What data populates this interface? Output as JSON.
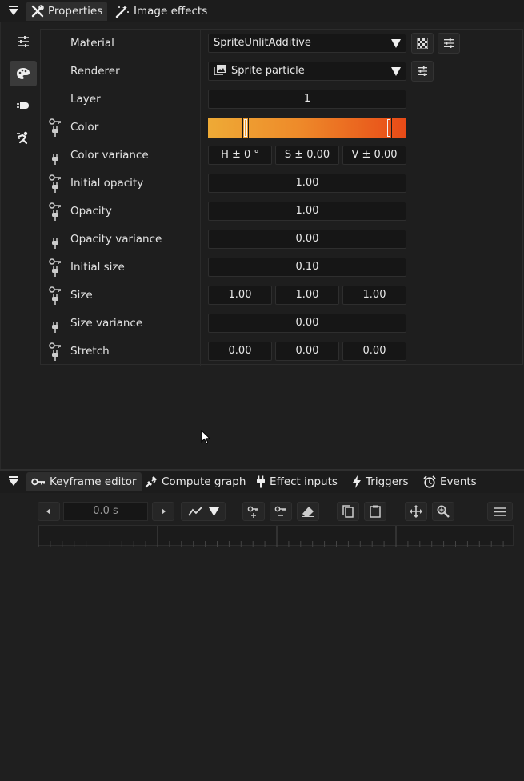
{
  "top_tabs": {
    "properties": "Properties",
    "image_effects": "Image effects"
  },
  "sidebar": {
    "items": [
      "settings-sliders-icon",
      "palette-icon",
      "particle-bullet-icon",
      "physics-person-icon"
    ],
    "active": "palette-icon"
  },
  "properties": {
    "material": {
      "label": "Material",
      "value": "SpriteUnlitAdditive"
    },
    "renderer": {
      "label": "Renderer",
      "value": "Sprite particle"
    },
    "layer": {
      "label": "Layer",
      "value": "1"
    },
    "color": {
      "label": "Color",
      "gradient_start": "#eeaa36",
      "gradient_end": "#e84a17"
    },
    "color_variance": {
      "label": "Color variance",
      "h": "H ± 0 °",
      "s": "S ± 0.00",
      "v": "V ± 0.00"
    },
    "initial_opacity": {
      "label": "Initial opacity",
      "value": "1.00"
    },
    "opacity": {
      "label": "Opacity",
      "value": "1.00"
    },
    "opacity_variance": {
      "label": "Opacity variance",
      "value": "0.00"
    },
    "initial_size": {
      "label": "Initial size",
      "value": "0.10"
    },
    "size": {
      "label": "Size",
      "x": "1.00",
      "y": "1.00",
      "z": "1.00"
    },
    "size_variance": {
      "label": "Size variance",
      "value": "0.00"
    },
    "stretch": {
      "label": "Stretch",
      "x": "0.00",
      "y": "0.00",
      "z": "0.00"
    }
  },
  "bottom_tabs": {
    "keyframe_editor": "Keyframe editor",
    "compute_graph": "Compute graph",
    "effect_inputs": "Effect inputs",
    "triggers": "Triggers",
    "events": "Events"
  },
  "keyframe_toolbar": {
    "time": "0.0 s"
  },
  "colors": {
    "background": "#1f1f1f",
    "field": "#161616",
    "text": "#e6e6e6"
  }
}
